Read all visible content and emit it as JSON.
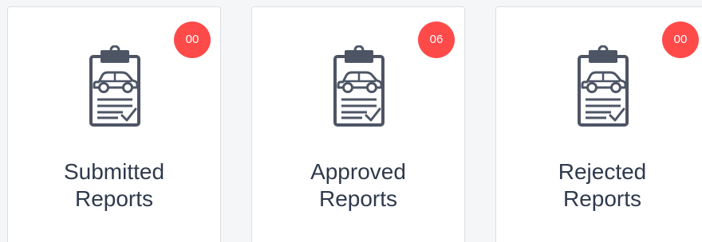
{
  "colors": {
    "badge": "#ff4a4a",
    "label_text": "#2e3a4c",
    "icon_stroke": "#4d5565"
  },
  "cards": [
    {
      "icon": "clipboard-car-report-icon",
      "count": "00",
      "label_line1": "Submitted",
      "label_line2": "Reports"
    },
    {
      "icon": "clipboard-car-report-icon",
      "count": "06",
      "label_line1": "Approved",
      "label_line2": "Reports"
    },
    {
      "icon": "clipboard-car-report-icon",
      "count": "00",
      "label_line1": "Rejected",
      "label_line2": "Reports"
    }
  ]
}
